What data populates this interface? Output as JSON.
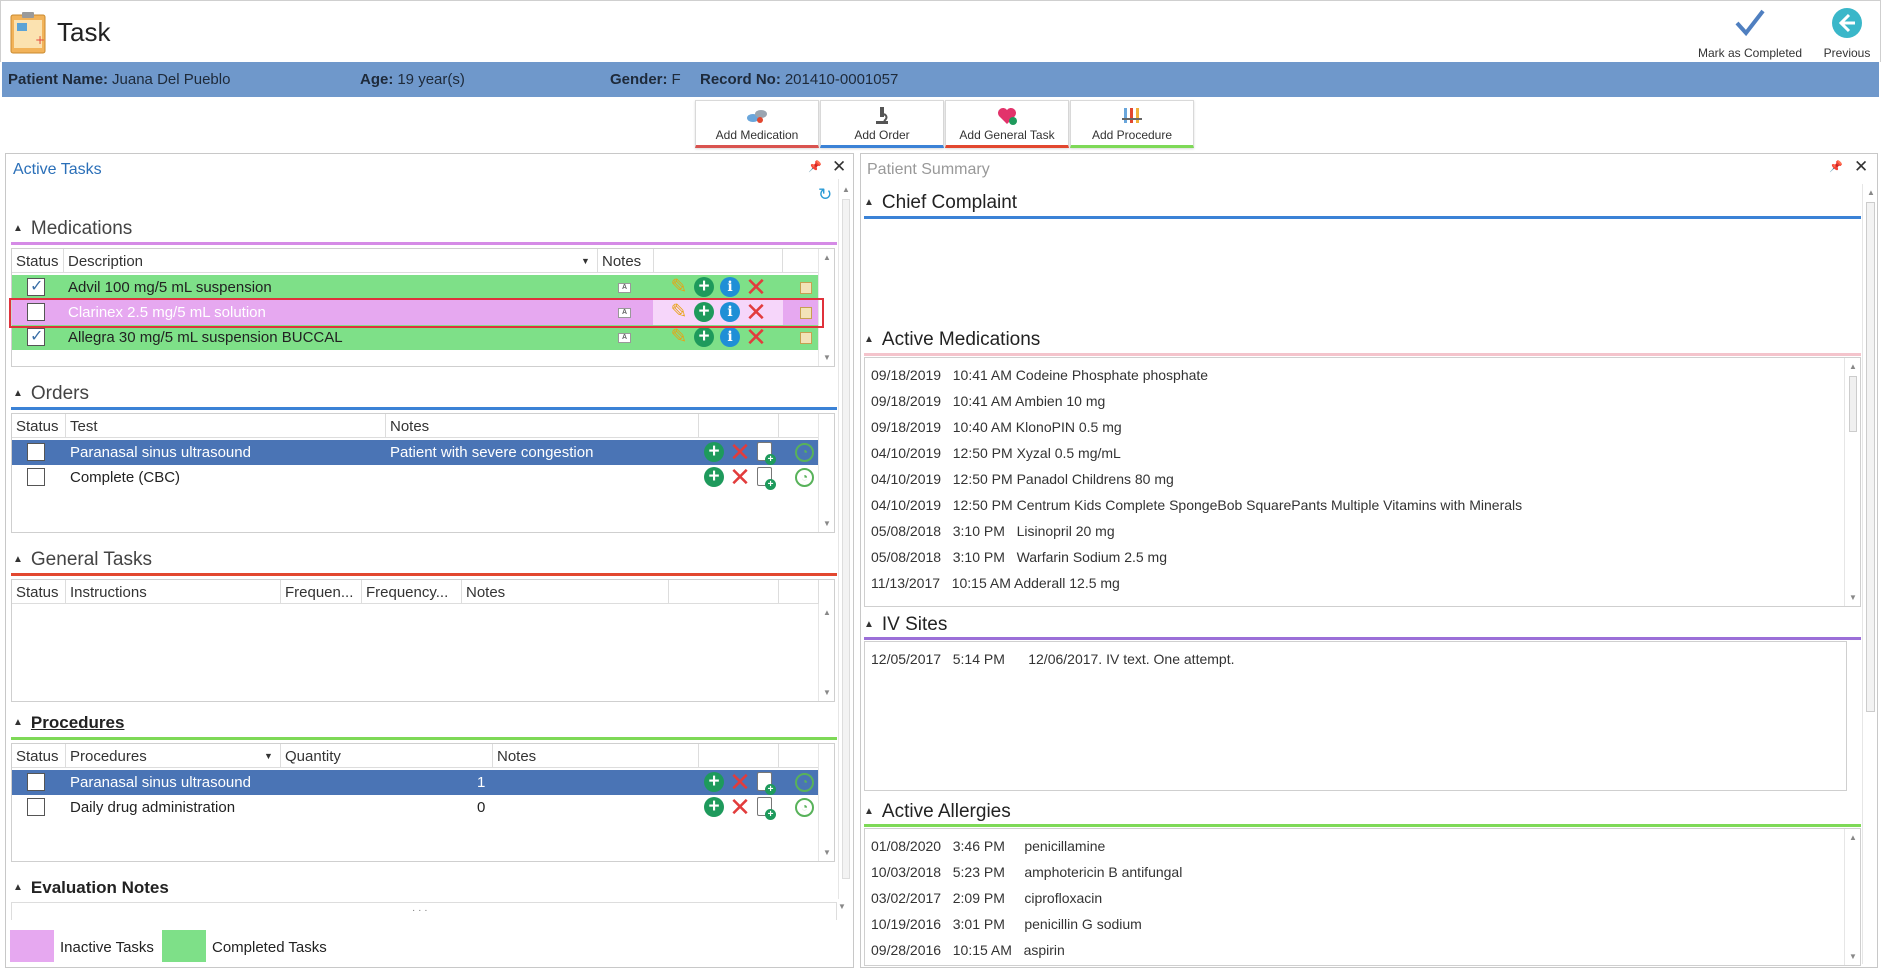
{
  "app": {
    "title": "Task",
    "mark_completed_label": "Mark as Completed",
    "previous_label": "Previous"
  },
  "patient": {
    "name_label": "Patient Name:",
    "name": "Juana Del Pueblo",
    "age_label": "Age:",
    "age": "19 year(s)",
    "gender_label": "Gender:",
    "gender": "F",
    "record_label": "Record No:",
    "record": "201410-0001057"
  },
  "add_buttons": [
    {
      "label": "Add Medication",
      "color": "#d9534f"
    },
    {
      "label": "Add Order",
      "color": "#3b82d6"
    },
    {
      "label": "Add General Task",
      "color": "#e2472f"
    },
    {
      "label": "Add Procedure",
      "color": "#7ed957"
    }
  ],
  "active_tasks": {
    "title": "Active Tasks",
    "medications": {
      "header": "Medications",
      "columns": [
        "Status",
        "Description",
        "Notes"
      ],
      "rows": [
        {
          "description": "Advil 100 mg/5 mL suspension",
          "checked": true,
          "state": "completed"
        },
        {
          "description": "Clarinex 2.5 mg/5 mL solution",
          "checked": false,
          "state": "inactive"
        },
        {
          "description": "Allegra 30 mg/5 mL suspension BUCCAL",
          "checked": true,
          "state": "completed"
        }
      ]
    },
    "orders": {
      "header": "Orders",
      "columns": [
        "Status",
        "Test",
        "Notes"
      ],
      "rows": [
        {
          "test": "Paranasal sinus ultrasound",
          "notes": "Patient with severe congestion",
          "selected": true
        },
        {
          "test": "Complete (CBC)",
          "notes": "",
          "selected": false
        }
      ]
    },
    "general_tasks": {
      "header": "General Tasks",
      "columns": [
        "Status",
        "Instructions",
        "Frequen...",
        "Frequency...",
        "Notes"
      ]
    },
    "procedures": {
      "header": "Procedures",
      "columns": [
        "Status",
        "Procedures",
        "Quantity",
        "Notes"
      ],
      "rows": [
        {
          "procedure": "Paranasal sinus ultrasound",
          "quantity": "1",
          "selected": true
        },
        {
          "procedure": "Daily drug administration",
          "quantity": "0",
          "selected": false
        }
      ]
    },
    "evaluation_notes": {
      "header": "Evaluation Notes",
      "ellipsis": "· · ·"
    }
  },
  "legend": {
    "inactive": "Inactive Tasks",
    "completed": "Completed Tasks"
  },
  "summary": {
    "title": "Patient Summary",
    "chief_complaint": "Chief Complaint",
    "active_medications": {
      "header": "Active Medications",
      "items": [
        {
          "date": "09/18/2019",
          "time": "10:41 AM",
          "name": "Codeine Phosphate",
          "dose": "phosphate"
        },
        {
          "date": "09/18/2019",
          "time": "10:41 AM",
          "name": "Ambien",
          "dose": "10 mg"
        },
        {
          "date": "09/18/2019",
          "time": "10:40 AM",
          "name": "KlonoPIN",
          "dose": "0.5 mg"
        },
        {
          "date": "04/10/2019",
          "time": "12:50 PM",
          "name": "Xyzal",
          "dose": "0.5 mg/mL"
        },
        {
          "date": "04/10/2019",
          "time": "12:50 PM",
          "name": "Panadol Childrens",
          "dose": "80 mg"
        },
        {
          "date": "04/10/2019",
          "time": "12:50 PM",
          "name": "Centrum Kids Complete SpongeBob SquarePants",
          "dose": "Multiple Vitamins with Minerals"
        },
        {
          "date": "05/08/2018",
          "time": "3:10 PM",
          "name": "Lisinopril",
          "dose": "20 mg"
        },
        {
          "date": "05/08/2018",
          "time": "3:10 PM",
          "name": "Warfarin Sodium",
          "dose": "2.5 mg"
        },
        {
          "date": "11/13/2017",
          "time": "10:15 AM",
          "name": "Adderall",
          "dose": "12.5 mg"
        }
      ]
    },
    "iv_sites": {
      "header": "IV Sites",
      "items": [
        {
          "date": "12/05/2017",
          "time": "5:14 PM",
          "text": "12/06/2017. IV text.  One attempt."
        }
      ]
    },
    "active_allergies": {
      "header": "Active Allergies",
      "items": [
        {
          "date": "01/08/2020",
          "time": "3:46 PM",
          "name": "penicillamine"
        },
        {
          "date": "10/03/2018",
          "time": "5:23 PM",
          "name": "amphotericin B antifungal"
        },
        {
          "date": "03/02/2017",
          "time": "2:09 PM",
          "name": "ciprofloxacin"
        },
        {
          "date": "10/19/2016",
          "time": "3:01 PM",
          "name": "penicillin G sodium"
        },
        {
          "date": "09/28/2016",
          "time": "10:15 AM",
          "name": "aspirin"
        }
      ]
    }
  },
  "colors": {
    "patient_bar": "#6f98cb",
    "completed": "#7ee088",
    "inactive": "#e6a8f0",
    "selected_row": "#4a74b5",
    "medications_rule": "#d58be6",
    "orders_rule": "#3b82d6",
    "general_rule": "#e2472f",
    "procedures_rule": "#7ed957",
    "highlight_box": "#e0313b"
  }
}
